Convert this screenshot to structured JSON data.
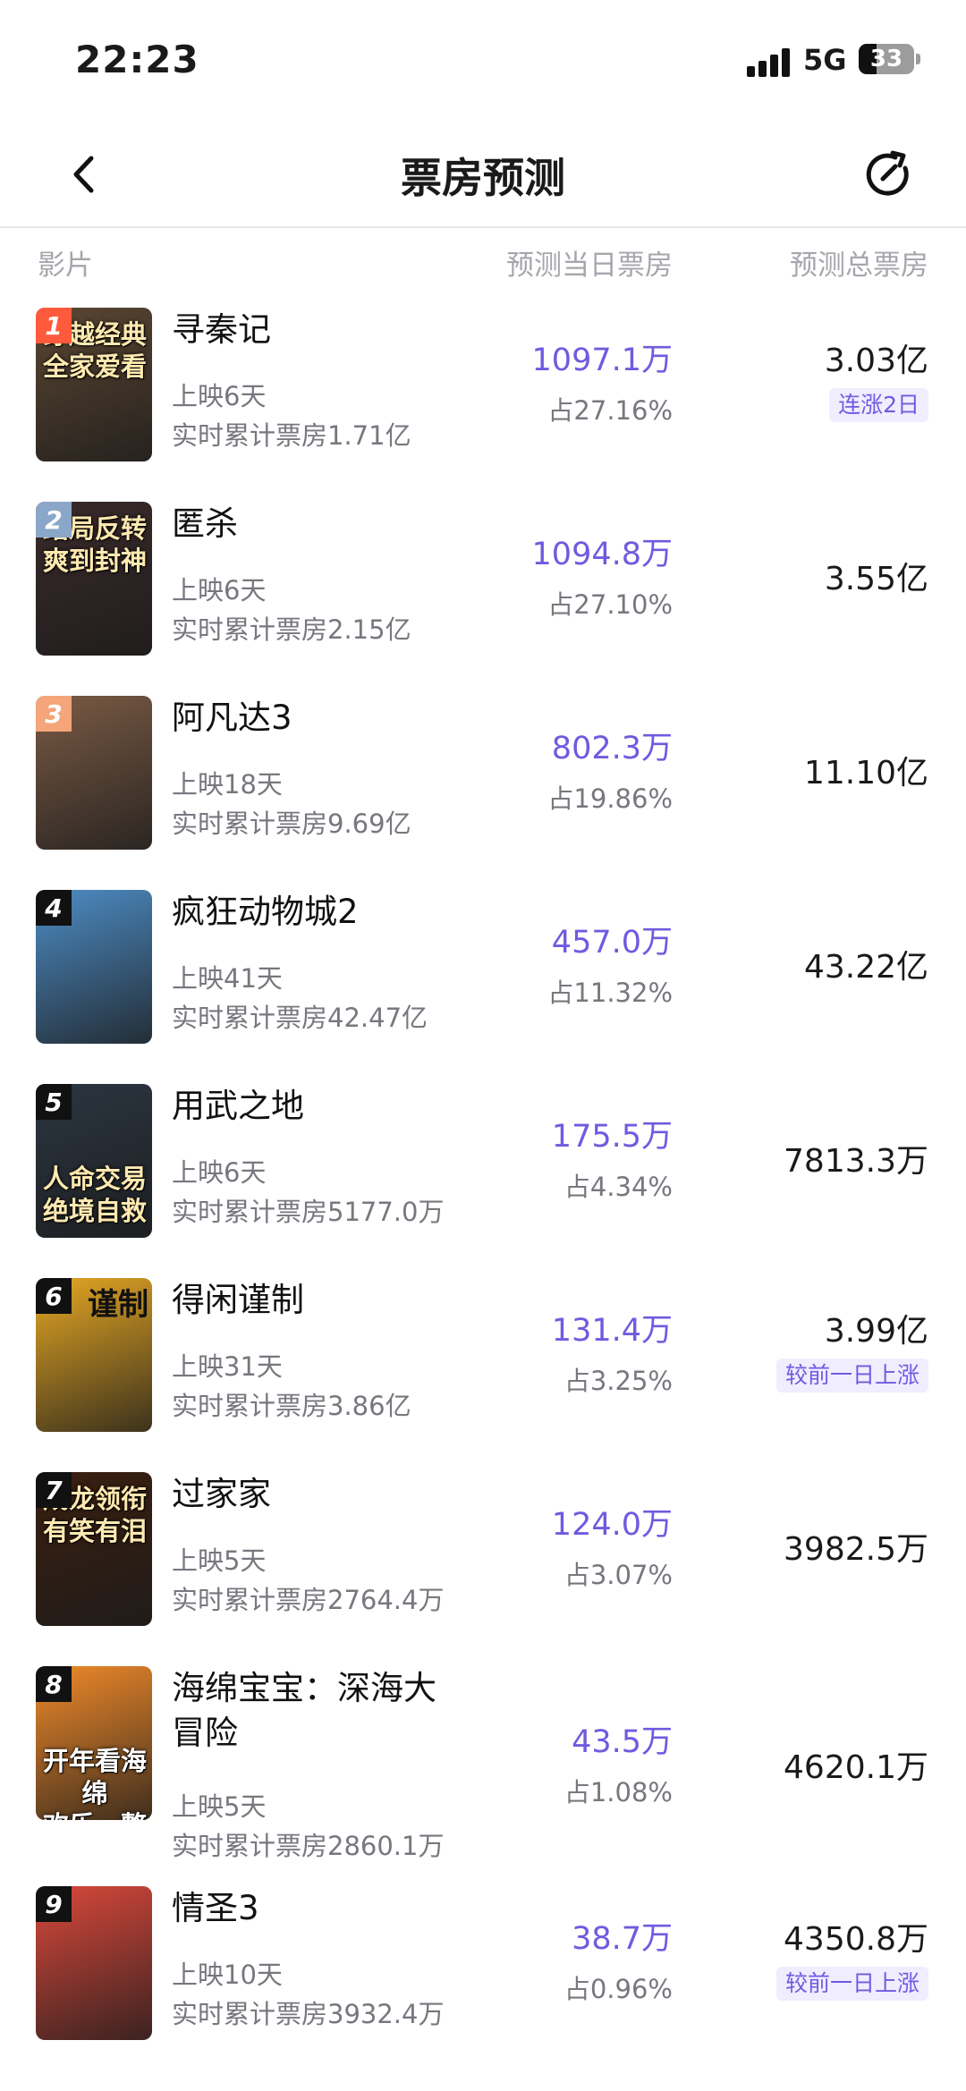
{
  "status_bar": {
    "time": "22:23",
    "network": "5G",
    "battery": "33",
    "battery_level": 0.33
  },
  "nav": {
    "title": "票房预测",
    "back_icon": "chevron-left-icon",
    "refresh_icon": "refresh-icon"
  },
  "columns": {
    "film": "影片",
    "pred_day": "预测当日票房",
    "pred_total": "预测总票房"
  },
  "movies": [
    {
      "rank": "1",
      "title": "寻秦记",
      "days": "上映6天",
      "realtime_total": "实时累计票房1.71亿",
      "pred_day": "1097.1万",
      "share": "占27.16%",
      "pred_total": "3.03亿",
      "tag": "连涨2日",
      "poster_text": "穿越经典\n全家爱看",
      "rank_color": "#ff5a3c",
      "poster_bg": "#5b4632"
    },
    {
      "rank": "2",
      "title": "匿杀",
      "days": "上映6天",
      "realtime_total": "实时累计票房2.15亿",
      "pred_day": "1094.8万",
      "share": "占27.10%",
      "pred_total": "3.55亿",
      "tag": "",
      "poster_text": "结局反转\n爽到封神",
      "rank_color": "#8aa6c8",
      "poster_bg": "#3a2a2a"
    },
    {
      "rank": "3",
      "title": "阿凡达3",
      "days": "上映18天",
      "realtime_total": "实时累计票房9.69亿",
      "pred_day": "802.3万",
      "share": "占19.86%",
      "pred_total": "11.10亿",
      "tag": "",
      "poster_text": "",
      "rank_color": "#f4a57a",
      "poster_bg": "#7a5a44"
    },
    {
      "rank": "4",
      "title": "疯狂动物城2",
      "days": "上映41天",
      "realtime_total": "实时累计票房42.47亿",
      "pred_day": "457.0万",
      "share": "占11.32%",
      "pred_total": "43.22亿",
      "tag": "",
      "poster_text": "",
      "rank_color": "#111111",
      "poster_bg": "#4d8cc4"
    },
    {
      "rank": "5",
      "title": "用武之地",
      "days": "上映6天",
      "realtime_total": "实时累计票房5177.0万",
      "pred_day": "175.5万",
      "share": "占4.34%",
      "pred_total": "7813.3万",
      "tag": "",
      "poster_text": "人命交易\n绝境自救",
      "rank_color": "#111111",
      "poster_bg": "#2b3540"
    },
    {
      "rank": "6",
      "title": "得闲谨制",
      "days": "上映31天",
      "realtime_total": "实时累计票房3.86亿",
      "pred_day": "131.4万",
      "share": "占3.25%",
      "pred_total": "3.99亿",
      "tag": "较前一日上涨",
      "poster_text": "谨制",
      "rank_color": "#111111",
      "poster_bg": "#e5a724"
    },
    {
      "rank": "7",
      "title": "过家家",
      "days": "上映5天",
      "realtime_total": "实时累计票房2764.4万",
      "pred_day": "124.0万",
      "share": "占3.07%",
      "pred_total": "3982.5万",
      "tag": "",
      "poster_text": "成龙领衔\n有笑有泪",
      "rank_color": "#111111",
      "poster_bg": "#3a1f10"
    },
    {
      "rank": "8",
      "title": "海绵宝宝：深海大冒险",
      "days": "上映5天",
      "realtime_total": "实时累计票房2860.1万",
      "pred_day": "43.5万",
      "share": "占1.08%",
      "pred_total": "4620.1万",
      "tag": "",
      "poster_text": "开年看海绵\n欢乐一整年",
      "rank_color": "#111111",
      "poster_bg": "#f08a2a"
    },
    {
      "rank": "9",
      "title": "情圣3",
      "days": "上映10天",
      "realtime_total": "实时累计票房3932.4万",
      "pred_day": "38.7万",
      "share": "占0.96%",
      "pred_total": "4350.8万",
      "tag": "较前一日上涨",
      "poster_text": "",
      "rank_color": "#111111",
      "poster_bg": "#d9483b"
    }
  ]
}
